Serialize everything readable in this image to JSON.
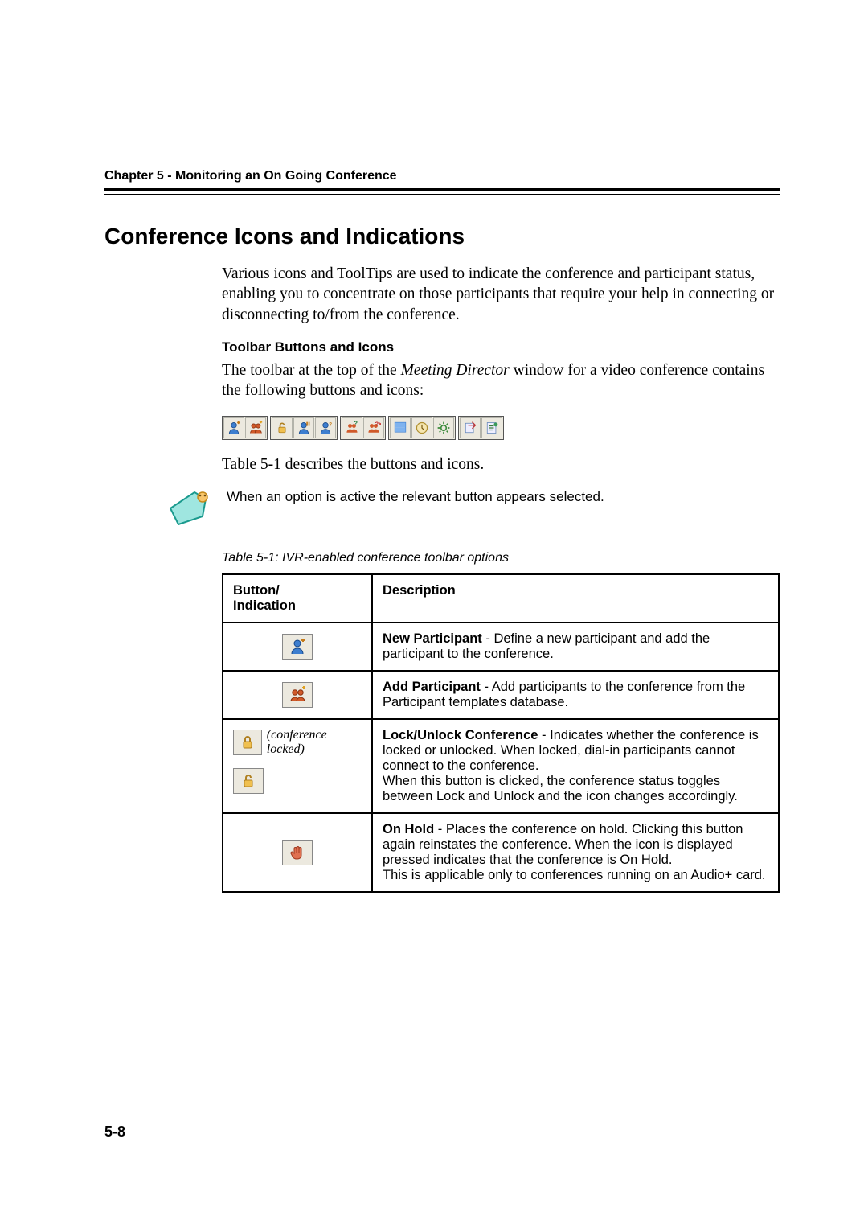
{
  "chapter": "Chapter 5 - Monitoring an On Going Conference",
  "section_title": "Conference Icons and Indications",
  "intro": "Various icons and ToolTips are used to indicate the conference and participant status, enabling you to concentrate on those participants that require your help in connecting or disconnecting to/from the conference.",
  "sub_heading": "Toolbar Buttons and Icons",
  "toolbar_sentence_pre": "The toolbar at the top of the ",
  "toolbar_sentence_em": "Meeting Director",
  "toolbar_sentence_post": " window for a video conference contains the following buttons and icons:",
  "toolbar_icons": [
    [
      "new-participant-icon",
      "add-participant-icon"
    ],
    [
      "unlock-icon",
      "on-hold-icon",
      "secure-icon"
    ],
    [
      "participant-q1-icon",
      "participant-q2-icon"
    ],
    [
      "layout-icon",
      "clock-icon",
      "settings-icon"
    ],
    [
      "export-icon",
      "report-icon"
    ]
  ],
  "after_toolbar": "Table 5-1 describes the buttons and icons.",
  "note": "When an option is active the relevant button appears selected.",
  "table_caption": "Table 5-1: IVR-enabled conference toolbar options",
  "table": {
    "head": [
      "Button/\nIndication",
      "Description"
    ],
    "rows": [
      {
        "icon": "new-participant-icon",
        "title": "New Participant",
        "desc": " - Define a new participant and add the participant to the conference."
      },
      {
        "icon": "add-participant-icon",
        "title": "Add Participant",
        "desc": " - Add participants to the conference from the Participant templates database."
      },
      {
        "icon": "lock-pair-icon",
        "lock_label": "(conference locked)",
        "title": "Lock/Unlock Conference",
        "desc": " - Indicates whether the conference is locked or unlocked. When locked, dial-in participants cannot connect to the conference.\nWhen this button is clicked, the conference status toggles between Lock and Unlock and the icon changes accordingly."
      },
      {
        "icon": "on-hold-hand-icon",
        "title": "On Hold",
        "desc": " - Places the conference on hold. Clicking this button again reinstates the conference. When the icon is displayed pressed indicates that the conference is On Hold.\nThis is applicable only to conferences running on an Audio+ card."
      }
    ]
  },
  "page_number": "5-8"
}
